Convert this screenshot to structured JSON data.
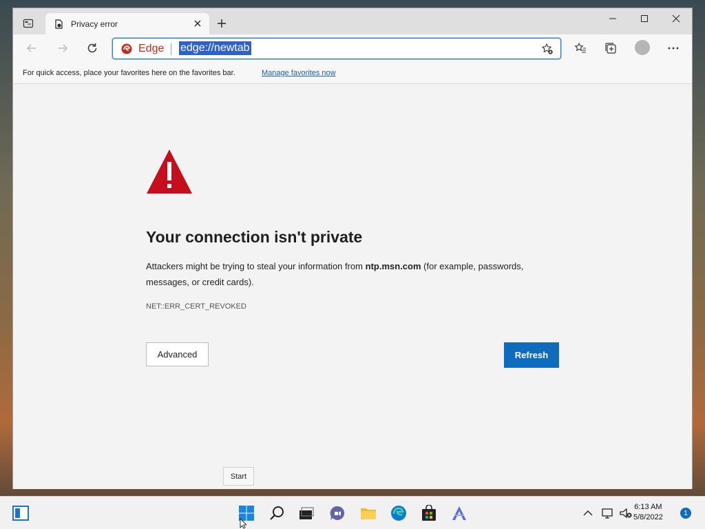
{
  "window": {
    "tab_title": "Privacy error"
  },
  "toolbar": {
    "site_label": "Edge",
    "url": "edge://newtab"
  },
  "favorites_bar": {
    "message": "For quick access, place your favorites here on the favorites bar.",
    "manage_link": "Manage favorites now"
  },
  "error_page": {
    "heading": "Your connection isn't private",
    "para_prefix": "Attackers might be trying to steal your information from",
    "para_host": "ntp.msn.com",
    "para_suffix": "(for example, passwords, messages, or credit cards).",
    "error_code": "NET::ERR_CERT_REVOKED",
    "advanced_label": "Advanced",
    "refresh_label": "Refresh"
  },
  "tooltip": {
    "text": "Start"
  },
  "taskbar": {
    "time": "6:13 AM",
    "date": "5/8/2022",
    "notification_count": "1"
  },
  "colors": {
    "accent": "#0f6cbd",
    "warning": "#c50f1f",
    "selection": "#2f62c9"
  },
  "icons": [
    "tab-actions-icon",
    "warning-favicon",
    "close-icon",
    "plus-icon",
    "minimize-icon",
    "maximize-icon",
    "window-close-icon",
    "back-icon",
    "forward-icon",
    "refresh-icon",
    "edge-logo-icon",
    "add-favorite-icon",
    "favorites-icon",
    "collections-icon",
    "profile-icon",
    "more-icon",
    "warning-triangle-icon",
    "widgets-icon",
    "start-icon",
    "search-icon",
    "task-view-icon",
    "chat-icon",
    "file-explorer-icon",
    "edge-icon",
    "store-icon",
    "app-icon",
    "chevron-up-icon",
    "network-icon",
    "volume-muted-icon"
  ]
}
